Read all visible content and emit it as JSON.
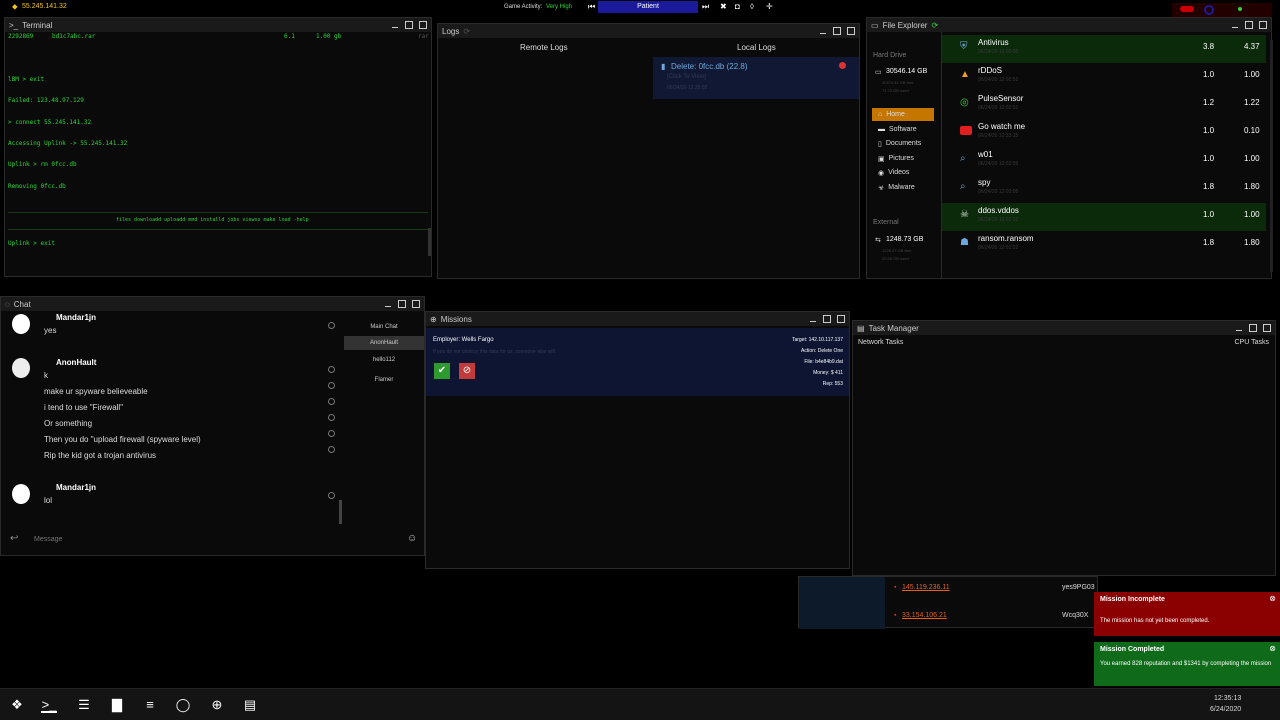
{
  "topbar": {
    "ip": "55.245.141.32",
    "game_activity_label": "Game Activity:",
    "game_activity_value": "Very High",
    "track": "Patient"
  },
  "terminal": {
    "title": "Terminal",
    "lines": [
      {
        "a": "2292869",
        "b": "bd1c7abc.rar",
        "c": "6.1",
        "d": "1.00 gb",
        "e": "rar"
      },
      {
        "text": "lBM > exit"
      },
      {
        "text": "Failed: 123.48.97.129"
      },
      {
        "text": "> connect 55.245.141.32"
      },
      {
        "text": "Accessing Uplink -> 55.245.141.32"
      },
      {
        "text": "Uplink > rm 0fcc.db"
      },
      {
        "text": "Removing 0fcc.db"
      }
    ],
    "commands": "files  downloadd  uploadd  mmd  installd  jobs  viewss  make  load  -help",
    "prompt": "Uplink > exit"
  },
  "logs": {
    "title": "Logs",
    "remote_label": "Remote Logs",
    "local_label": "Local Logs",
    "entry_title": "Delete: 0fcc.db (22.8)",
    "entry_sub": "[Click To View]",
    "entry_time": "06/24/20 12:35:02"
  },
  "file_explorer": {
    "title": "File Explorer",
    "hard_drive_label": "Hard Drive",
    "hd_size": "30546.14 GB",
    "hd_free": "30474.41 GB free",
    "hd_used": "71.73 GB used",
    "sidebar": [
      "Home",
      "Software",
      "Documents",
      "Pictures",
      "Videos",
      "Malware"
    ],
    "external_label": "External",
    "ext_size": "1248.73 GB",
    "ext_free": "1228.47 GB free",
    "ext_used": "20.26 GB used",
    "files": [
      {
        "name": "Antivirus",
        "date": "06/24/20 12:02:05",
        "v1": "3.8",
        "v2": "4.37",
        "icon": "shield-icon",
        "color": "#6fa8dc"
      },
      {
        "name": "rDDoS",
        "date": "06/24/20 12:02:51",
        "v1": "1.0",
        "v2": "1.00",
        "icon": "warning-icon",
        "color": "#f0a020"
      },
      {
        "name": "PulseSensor",
        "date": "06/24/20 12:02:51",
        "v1": "1.2",
        "v2": "1.22",
        "icon": "radar-icon",
        "color": "#2dd53a"
      },
      {
        "name": "Go watch me",
        "date": "06/24/20 12:33:15",
        "v1": "1.0",
        "v2": "0.10",
        "icon": "youtube-icon",
        "color": "#e02020"
      },
      {
        "name": "w01",
        "date": "06/24/20 12:02:59",
        "v1": "1.0",
        "v2": "1.00",
        "icon": "spy-icon",
        "color": "#6fa8dc"
      },
      {
        "name": "spy",
        "date": "06/24/20 12:02:05",
        "v1": "1.8",
        "v2": "1.80",
        "icon": "spy-icon",
        "color": "#6fa8dc"
      },
      {
        "name": "ddos.vddos",
        "date": "06/24/20 12:02:52",
        "v1": "1.0",
        "v2": "1.00",
        "icon": "skull-icon",
        "color": "#ddd"
      },
      {
        "name": "ransom.ransom",
        "date": "06/24/20 12:02:52",
        "v1": "1.8",
        "v2": "1.80",
        "icon": "ransom-icon",
        "color": "#6fa8dc"
      }
    ]
  },
  "chat": {
    "title": "Chat",
    "messages": [
      {
        "user": "Mandar1jn",
        "lines": [
          "yes"
        ]
      },
      {
        "user": "AnonHault",
        "lines": [
          "k",
          "make ur spyware believeable",
          "i tend to use \"Firewall\"",
          "Or something",
          "Then you do \"upload firewall (spyware level)",
          "Rip the kid got a trojan antivirus"
        ]
      },
      {
        "user": "Mandar1jn",
        "lines": [
          "lol"
        ]
      }
    ],
    "channels": [
      "Main Chat",
      "AnonHault",
      "hello112",
      "Flamer"
    ],
    "placeholder": "Message"
  },
  "missions": {
    "title": "Missions",
    "employer": "Employer: Wells Fargo",
    "description": "If you do not destroy this data for us, someone else will.",
    "target": "Target: 142.10.117.137",
    "action": "Action: Delete One",
    "file": "File: b4e84b9.dat",
    "money": "Money: $ 411",
    "rep": "Rep: 553"
  },
  "task_manager": {
    "title": "Task Manager",
    "network_tab": "Network Tasks",
    "cpu_tab": "CPU Tasks",
    "rows": [
      {
        "ip": "145.119.236.11",
        "name": "yes9PG03"
      },
      {
        "ip": "33.154.106.21",
        "name": "Wcq30X"
      }
    ]
  },
  "toasts": [
    {
      "title": "Mission Incomplete",
      "body": "The mission has not yet been completed.",
      "color": "#8b0000"
    },
    {
      "title": "Mission Completed",
      "body": "You earned 828 reputation and $1341 by completing the mission",
      "color": "#0f6b1a"
    }
  ],
  "clock": {
    "time": "12:35:13",
    "date": "6/24/2020"
  }
}
